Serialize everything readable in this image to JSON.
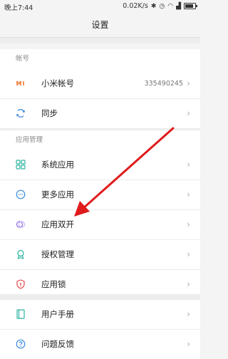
{
  "status": {
    "time": "晚上7:44",
    "speed": "0.02K/s"
  },
  "header": {
    "title": "设置"
  },
  "account_section": {
    "label": "帐号",
    "items": [
      {
        "label": "小米帐号",
        "value": "335490245"
      },
      {
        "label": "同步"
      }
    ]
  },
  "apps_section": {
    "label": "应用管理",
    "items": [
      {
        "label": "系统应用"
      },
      {
        "label": "更多应用"
      },
      {
        "label": "应用双开"
      },
      {
        "label": "授权管理"
      },
      {
        "label": "应用锁"
      }
    ]
  },
  "help_section": {
    "items": [
      {
        "label": "用户手册"
      },
      {
        "label": "问题反馈"
      }
    ]
  },
  "icons": {
    "mi_logo": "MI",
    "chevron": "›"
  },
  "colors": {
    "accent_orange": "#f26d21",
    "icon_teal": "#2bb3a0",
    "icon_blue": "#3c8de0",
    "icon_purple": "#8a6de8",
    "icon_red": "#e24b4b",
    "annotation_arrow": "#e01b1b"
  }
}
